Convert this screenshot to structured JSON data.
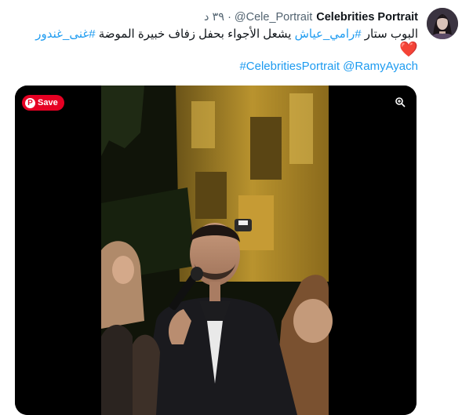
{
  "tweet": {
    "author": {
      "display_name": "Celebrities Portrait",
      "handle": "@Cele_Portrait",
      "separator": "·",
      "timestamp": "٣٩ د"
    },
    "text": {
      "line1_plain": "البوب ستار ",
      "line1_hashtag1": "#رامي_عياش",
      "line1_middle": " يشعل الأجواء بحفل زفاف خبيرة الموضة ",
      "line1_hashtag2": "#غنى_غندور",
      "heart": "❤️",
      "line3_hashtag": "#CelebritiesPortrait",
      "line3_mention": "@RamyAyach"
    },
    "media": {
      "save_label": "Save",
      "pinterest_icon": "pinterest-icon",
      "zoom_icon": "zoom-icon"
    }
  },
  "colors": {
    "accent": "#1d9bf0",
    "text": "#0f1419",
    "muted": "#536471",
    "heart": "#e0245e",
    "save_button": "#e60023"
  }
}
